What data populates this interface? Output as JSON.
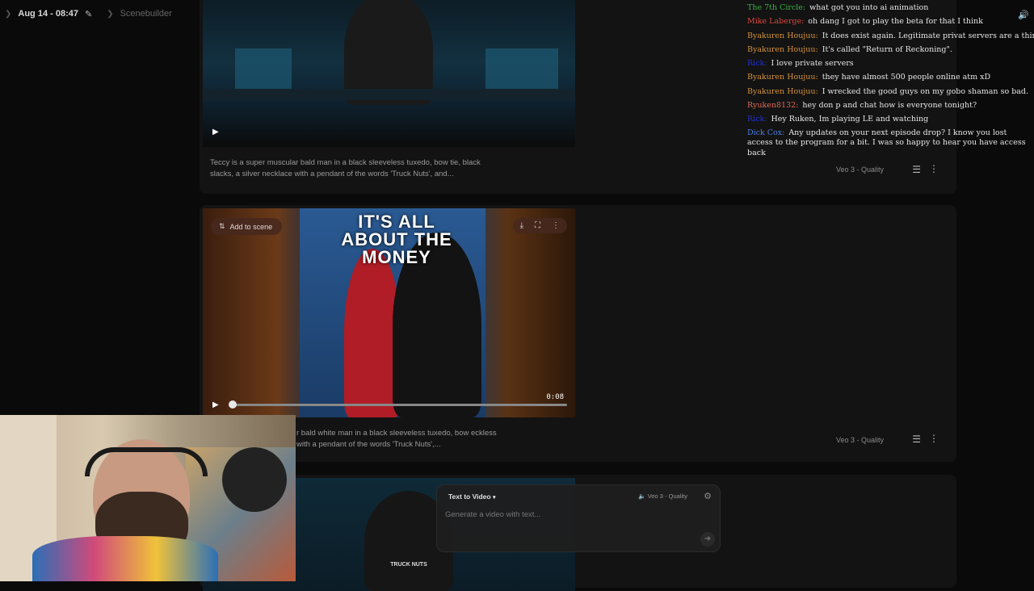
{
  "topbar": {
    "date": "Aug 14 - 08:47",
    "breadcrumb": "Scenebuilder"
  },
  "cards": [
    {
      "description": "Teccy is a super muscular bald man in a black sleeveless tuxedo, bow tie, black slacks, a silver necklace with a pendant of the words 'Truck Nuts', and...",
      "model": "Veo 3 - Quality"
    },
    {
      "add_to_scene": "Add to scene",
      "poster_title": "IT'S ALL ABOUT THE MONEY",
      "duration": "0:08",
      "description": "r bald white man in a black sleeveless tuxedo, bow eckless with a pendant of the words 'Truck Nuts',...",
      "model": "Veo 3 - Quality"
    },
    {
      "shirt_text": "TRUCK NUTS"
    }
  ],
  "composer": {
    "mode": "Text to Video",
    "model": "Veo 3 - Quality",
    "placeholder": "Generate a video with text..."
  },
  "chat": [
    {
      "user": "The 7th Circle:",
      "color": "#3fae4a",
      "text": "what got you into ai animation"
    },
    {
      "user": "Mike Laberge:",
      "color": "#e0463a",
      "text": "oh dang I got to play the beta for that I think"
    },
    {
      "user": "Byakuren Houjuu:",
      "color": "#d4913a",
      "text": "It does exist again. Legitimate privat servers are a thing."
    },
    {
      "user": "Byakuren Houjuu:",
      "color": "#d4913a",
      "text": "It's called \"Return of Reckoning\"."
    },
    {
      "user": "Rick:",
      "color": "#1f2fd6",
      "text": "I love private servers"
    },
    {
      "user": "Byakuren Houjuu:",
      "color": "#d4913a",
      "text": "they have almost 500 people online atm xD"
    },
    {
      "user": "Byakuren Houjuu:",
      "color": "#d4913a",
      "text": "I wrecked the good guys on my gobo shaman so bad."
    },
    {
      "user": "Ryuken8132:",
      "color": "#e06a5a",
      "text": "hey don p and chat how is everyone tonight?"
    },
    {
      "user": "Rick:",
      "color": "#1f2fd6",
      "text": "Hey Ruken, Im playing LE and watching"
    },
    {
      "user": "Dick Cox:",
      "color": "#4a7fe0",
      "text": "Any updates on your next episode drop? I know you lost access to the program for a bit. I was so happy to hear you have access back"
    }
  ]
}
